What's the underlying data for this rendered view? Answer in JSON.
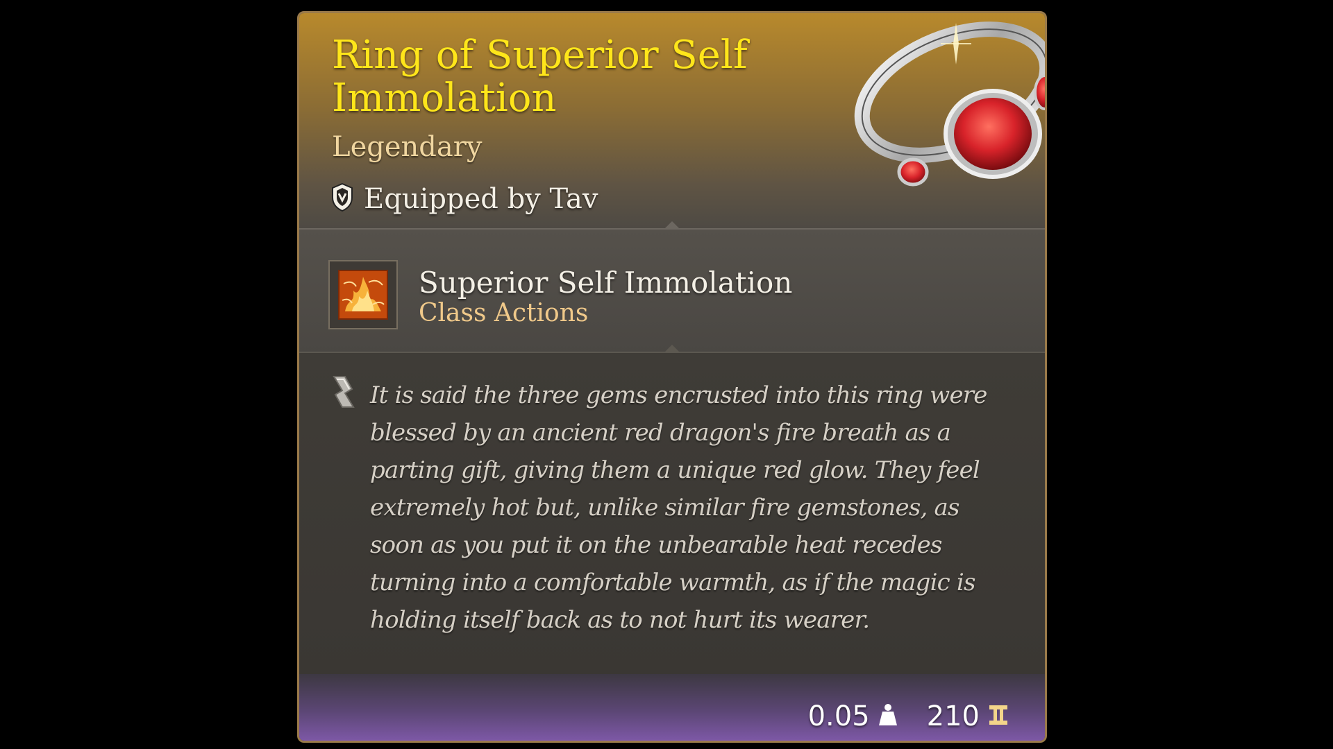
{
  "item": {
    "name": "Ring of Superior Self Immolation",
    "rarity": "Legendary",
    "equipped_by": "Equipped by Tav",
    "rarity_color": "#ffe61a",
    "icon": "ring-icon"
  },
  "action": {
    "name": "Superior Self Immolation",
    "type": "Class Actions",
    "icon": "flame-action-icon"
  },
  "description": {
    "text": "It is said the three gems encrusted into this ring were blessed by an ancient red dragon's fire breath as a parting gift, giving them a unique red glow. They feel extremely hot but, unlike similar fire gemstones, as soon as you put it on the unbearable heat recedes turning into a comfortable warmth, as if the magic is holding itself back as to not hurt its wearer.",
    "icon": "scroll-icon"
  },
  "footer": {
    "weight": "0.05",
    "weight_icon": "weight-icon",
    "value": "210",
    "value_icon": "gold-coin-icon"
  }
}
